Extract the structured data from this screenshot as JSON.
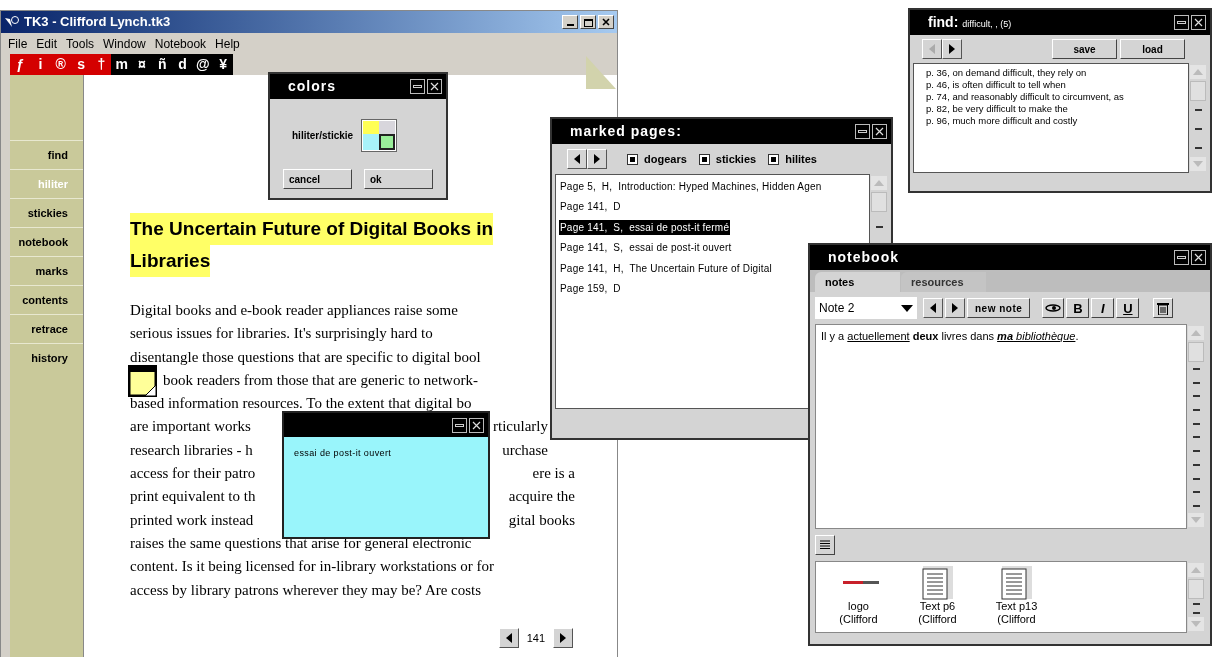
{
  "main_window": {
    "title": "TK3 - Clifford Lynch.tk3",
    "menu": [
      "File",
      "Edit",
      "Tools",
      "Window",
      "Notebook",
      "Help"
    ],
    "toolbar": [
      {
        "glyph": "ƒ",
        "color": "#d40000"
      },
      {
        "glyph": "i",
        "color": "#d40000"
      },
      {
        "glyph": "®",
        "color": "#d40000"
      },
      {
        "glyph": "s",
        "color": "#d40000"
      },
      {
        "glyph": "†",
        "color": "#d40000"
      },
      {
        "glyph": "m",
        "color": "#000000"
      },
      {
        "glyph": "¤",
        "color": "#000000"
      },
      {
        "glyph": "ñ",
        "color": "#000000"
      },
      {
        "glyph": "d",
        "color": "#000000"
      },
      {
        "glyph": "@",
        "color": "#000000"
      },
      {
        "glyph": "¥",
        "color": "#000000"
      }
    ],
    "sidebar": [
      {
        "label": "find",
        "selected": false
      },
      {
        "label": "hiliter",
        "selected": true
      },
      {
        "label": "stickies",
        "selected": false
      },
      {
        "label": "notebook",
        "selected": false
      },
      {
        "label": "marks",
        "selected": false
      },
      {
        "label": "contents",
        "selected": false
      },
      {
        "label": "retrace",
        "selected": false
      },
      {
        "label": "history",
        "selected": false
      }
    ],
    "document": {
      "heading": [
        "The Uncertain Future of Digital Books in",
        "Libraries"
      ],
      "lines": [
        {
          "parts": [
            "Digital books and e-book reader appliances raise some"
          ],
          "sticky": false
        },
        {
          "parts": [
            "serious issues for libraries. It's surprisingly hard to"
          ],
          "sticky": false
        },
        {
          "parts": [
            "disentangle those questions that are specific to digital bool"
          ],
          "sticky": false
        },
        {
          "parts": [
            "book readers from those that are generic to network-"
          ],
          "sticky": true
        },
        {
          "parts": [
            "based information resources. To the extent that digital bo"
          ],
          "sticky": false
        },
        {
          "parts": [
            "are important works",
            "rticularly"
          ],
          "sticky": false
        },
        {
          "parts": [
            "research libraries - h",
            "urchase"
          ],
          "sticky": false
        },
        {
          "parts": [
            "access for their patro",
            "ere is a"
          ],
          "sticky": false
        },
        {
          "parts": [
            "print equivalent to th",
            "acquire the"
          ],
          "sticky": false
        },
        {
          "parts": [
            "printed work instead",
            "gital books"
          ],
          "sticky": false
        },
        {
          "parts": [
            "raises the same questions that arise for general electronic"
          ],
          "sticky": false
        },
        {
          "parts": [
            "content. Is it being licensed for in-library workstations or for"
          ],
          "sticky": false
        },
        {
          "parts": [
            "access by library patrons wherever they may be? Are costs"
          ],
          "sticky": false
        }
      ],
      "page": "141"
    }
  },
  "colors_dialog": {
    "title": "colors",
    "label": "hiliter/stickie",
    "swatches": [
      {
        "color": "#ffff55",
        "selected": false
      },
      {
        "color": "#d8d6dc",
        "selected": false
      },
      {
        "color": "#a8f2fa",
        "selected": false
      },
      {
        "color": "#99ee99",
        "selected": true
      }
    ],
    "buttons": [
      "cancel",
      "ok"
    ]
  },
  "marked_pages": {
    "title": "marked pages:",
    "filters": [
      {
        "label": "dogears",
        "checked": true
      },
      {
        "label": "stickies",
        "checked": true
      },
      {
        "label": "hilites",
        "checked": true
      }
    ],
    "rows": [
      {
        "text": "Page 5,  H,  Introduction: Hyped Machines, Hidden Agen",
        "selected": false
      },
      {
        "text": "Page 141,  D",
        "selected": false
      },
      {
        "text": "Page 141,  S,  essai de post-it fermé",
        "selected": true
      },
      {
        "text": "Page 141,  S,  essai de post-it ouvert",
        "selected": false
      },
      {
        "text": "Page 141,  H,  The Uncertain Future of Digital",
        "selected": false
      },
      {
        "text": "Page 159,  D",
        "selected": false
      }
    ]
  },
  "find": {
    "title": "find:",
    "query": "difficult, , (5)",
    "back_disabled": true,
    "buttons": [
      "save",
      "load"
    ],
    "results": [
      "p. 36, on demand difficult, they rely on",
      "p. 46, is often difficult to tell when",
      "p. 74, and reasonably difficult to circumvent, as",
      "p. 82, be very difficult to make the",
      "p. 96, much more difficult and costly"
    ]
  },
  "sticky_note": {
    "text": "essai de post-it ouvert"
  },
  "notebook": {
    "title": "notebook",
    "tabs": [
      {
        "label": "notes",
        "selected": true
      },
      {
        "label": "resources",
        "selected": false
      }
    ],
    "note": "Note 2",
    "new_note": "new note",
    "format_buttons": [
      {
        "kind": "bold",
        "label": "B"
      },
      {
        "kind": "italic",
        "label": "I"
      },
      {
        "kind": "underline",
        "label": "U"
      }
    ],
    "content": [
      {
        "text": "Il y a ",
        "bold": false,
        "italic": false,
        "underline": false
      },
      {
        "text": "actuellement",
        "bold": false,
        "italic": false,
        "underline": true
      },
      {
        "text": " deux",
        "bold": true,
        "italic": false,
        "underline": false
      },
      {
        "text": " livres dans ",
        "bold": false,
        "italic": false,
        "underline": false
      },
      {
        "text": "ma",
        "bold": true,
        "italic": true,
        "underline": true
      },
      {
        "text": " bibliothèque",
        "bold": false,
        "italic": true,
        "underline": true
      },
      {
        "text": ".",
        "bold": false,
        "italic": false,
        "underline": false
      }
    ],
    "resources": [
      {
        "kind": "logo",
        "label": "logo (Clifford"
      },
      {
        "kind": "text",
        "label": "Text p6 (Clifford"
      },
      {
        "kind": "text",
        "label": "Text p13 (Clifford"
      }
    ]
  }
}
